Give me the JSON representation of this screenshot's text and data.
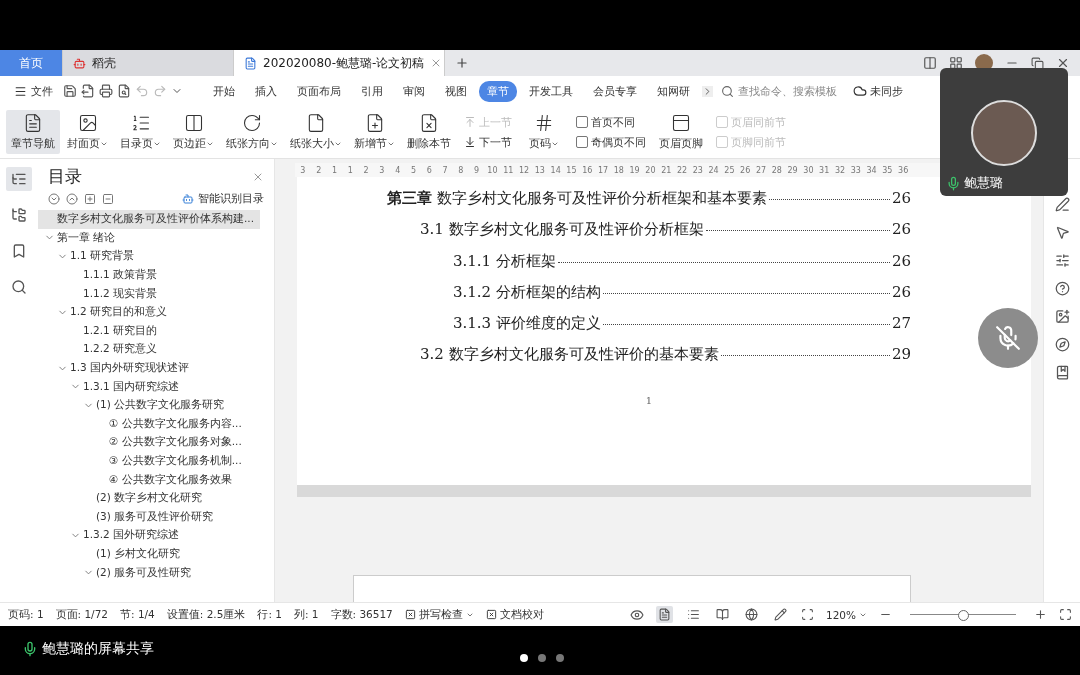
{
  "tabs": [
    {
      "label": "首页",
      "kind": "home",
      "selected": false
    },
    {
      "label": "稻壳",
      "kind": "app",
      "selected": false
    },
    {
      "label": "202020080-鲍慧璐-论文初稿",
      "kind": "doc",
      "selected": true
    }
  ],
  "menu": {
    "file": "文件",
    "items": [
      {
        "label": "开始",
        "selected": false
      },
      {
        "label": "插入",
        "selected": false
      },
      {
        "label": "页面布局",
        "selected": false
      },
      {
        "label": "引用",
        "selected": false
      },
      {
        "label": "审阅",
        "selected": false
      },
      {
        "label": "视图",
        "selected": false
      },
      {
        "label": "章节",
        "selected": true
      },
      {
        "label": "开发工具",
        "selected": false
      },
      {
        "label": "会员专享",
        "selected": false
      },
      {
        "label": "知网研",
        "selected": false
      }
    ],
    "search": {
      "placeholder": "查找命令、搜索模板"
    },
    "sync": "未同步"
  },
  "ribbon": {
    "large": [
      {
        "label": "章节导航",
        "dropdown": false,
        "selected": true
      },
      {
        "label": "封面页",
        "dropdown": true,
        "selected": false
      },
      {
        "label": "目录页",
        "dropdown": true,
        "selected": false
      },
      {
        "label": "页边距",
        "dropdown": true,
        "selected": false
      },
      {
        "label": "纸张方向",
        "dropdown": true,
        "selected": false
      },
      {
        "label": "纸张大小",
        "dropdown": true,
        "selected": false
      },
      {
        "label": "新增节",
        "dropdown": true,
        "selected": false
      },
      {
        "label": "删除本节",
        "dropdown": false,
        "selected": false
      }
    ],
    "nav": [
      {
        "label": "上一节",
        "disabled": true
      },
      {
        "label": "下一节",
        "disabled": false
      }
    ],
    "page_number": {
      "label": "页码",
      "dropdown": true
    },
    "checks": [
      {
        "label": "首页不同",
        "checked": false,
        "disabled": false
      },
      {
        "label": "奇偶页不同",
        "checked": false,
        "disabled": false
      }
    ],
    "header_footer": {
      "label": "页眉页脚"
    },
    "link_checks": [
      {
        "label": "页眉同前节",
        "checked": false,
        "disabled": true
      },
      {
        "label": "页脚同前节",
        "checked": false,
        "disabled": true
      }
    ]
  },
  "toc": {
    "title": "目录",
    "smart": "智能识别目录",
    "items": [
      {
        "label": "数字乡村文化服务可及性评价体系构建...",
        "selected": true
      },
      {
        "label": "第一章 绪论",
        "selected": false,
        "expanded": true,
        "children": [
          {
            "label": "1.1 研究背景",
            "selected": false,
            "expanded": true,
            "children": [
              {
                "label": "1.1.1 政策背景",
                "selected": false
              },
              {
                "label": "1.1.2 现实背景",
                "selected": false
              }
            ]
          },
          {
            "label": "1.2 研究目的和意义",
            "selected": false,
            "expanded": true,
            "children": [
              {
                "label": "1.2.1 研究目的",
                "selected": false
              },
              {
                "label": "1.2.2 研究意义",
                "selected": false
              }
            ]
          },
          {
            "label": "1.3 国内外研究现状述评",
            "selected": false,
            "expanded": true,
            "children": [
              {
                "label": "1.3.1 国内研究综述",
                "selected": false,
                "expanded": true,
                "children": [
                  {
                    "label": "(1) 公共数字文化服务研究",
                    "selected": false,
                    "expanded": true,
                    "children": [
                      {
                        "label": "① 公共数字文化服务内容...",
                        "selected": false
                      },
                      {
                        "label": "② 公共数字文化服务对象...",
                        "selected": false
                      },
                      {
                        "label": "③ 公共数字文化服务机制...",
                        "selected": false
                      },
                      {
                        "label": "④ 公共数字文化服务效果",
                        "selected": false
                      }
                    ]
                  },
                  {
                    "label": "(2) 数字乡村文化研究",
                    "selected": false
                  },
                  {
                    "label": "(3) 服务可及性评价研究",
                    "selected": false
                  }
                ]
              },
              {
                "label": "1.3.2 国外研究综述",
                "selected": false,
                "expanded": true,
                "children": [
                  {
                    "label": "(1) 乡村文化研究",
                    "selected": false
                  },
                  {
                    "label": "(2) 服务可及性研究",
                    "selected": false,
                    "expanded": true
                  }
                ]
              }
            ]
          }
        ]
      }
    ]
  },
  "ruler": [
    "3",
    "2",
    "1",
    "1",
    "2",
    "3",
    "4",
    "5",
    "6",
    "7",
    "8",
    "9",
    "10",
    "11",
    "12",
    "13",
    "14",
    "15",
    "16",
    "17",
    "18",
    "19",
    "20",
    "21",
    "22",
    "23",
    "24",
    "25",
    "26",
    "27",
    "28",
    "29",
    "30",
    "31",
    "32",
    "33",
    "34",
    "35",
    "36"
  ],
  "document": {
    "entries": [
      {
        "title": "**第三章** 数字乡村文化服务可及性评价分析框架和基本要素",
        "page": "26",
        "children": [
          {
            "title": "3.1 数字乡村文化服务可及性评价分析框架",
            "page": "26",
            "children": [
              {
                "title": "3.1.1 分析框架",
                "page": "26"
              },
              {
                "title": "3.1.2 分析框架的结构",
                "page": "26"
              },
              {
                "title": "3.1.3 评价维度的定义",
                "page": "27"
              }
            ]
          },
          {
            "title": "3.2 数字乡村文化服务可及性评价的基本要素",
            "page": "29"
          }
        ]
      }
    ],
    "page_number": "1"
  },
  "status": {
    "items": [
      "页码: 1",
      "页面: 1/72",
      "节: 1/4",
      "设置值: 2.5厘米",
      "行: 1",
      "列: 1",
      "字数: 36517"
    ],
    "spell": "拼写检查",
    "proof": "文档校对",
    "views": [
      {
        "kind": "page",
        "selected": true
      },
      {
        "kind": "outline",
        "selected": false
      },
      {
        "kind": "read",
        "selected": false
      },
      {
        "kind": "web",
        "selected": false
      },
      {
        "kind": "write",
        "selected": false
      }
    ],
    "zoom": "120%",
    "zoom_level": {
      "level": 0.5
    }
  },
  "call": {
    "name": "鲍慧璐",
    "muted": true
  },
  "share": {
    "text": "鲍慧璐的屏幕共享",
    "dots": [
      {
        "selected": true
      },
      {
        "selected": false
      },
      {
        "selected": false
      }
    ]
  }
}
